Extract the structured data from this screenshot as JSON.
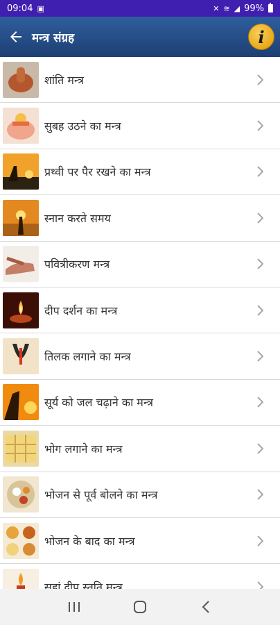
{
  "status_bar": {
    "time": "09:04",
    "battery": "99%"
  },
  "header": {
    "title": "मन्त्र संग्रह"
  },
  "items": [
    {
      "label": "शांति मन्त्र",
      "icon": "hands-namaste-icon"
    },
    {
      "label": "सुबह उठने का मन्त्र",
      "icon": "palms-open-icon"
    },
    {
      "label": "प्रथ्वी पर पैर रखने का मन्त्र",
      "icon": "yoga-sunset-icon"
    },
    {
      "label": "स्नान करते समय",
      "icon": "sun-prayer-icon"
    },
    {
      "label": "पवित्रीकरण मन्त्र",
      "icon": "water-pour-icon"
    },
    {
      "label": "दीप दर्शन का मन्त्र",
      "icon": "diya-lamp-icon"
    },
    {
      "label": "तिलक लगाने का मन्त्र",
      "icon": "tilak-icon"
    },
    {
      "label": "सूर्य को जल चढ़ाने का मन्त्र",
      "icon": "sun-offering-icon"
    },
    {
      "label": "भोग लगाने का मन्त्र",
      "icon": "sweets-plate-icon"
    },
    {
      "label": "भोजन से पूर्व बोलने का मन्त्र",
      "icon": "food-thali-icon"
    },
    {
      "label": "भोजन के बाद का मन्त्र",
      "icon": "food-bowls-icon"
    },
    {
      "label": "सहां दीप स्तुति मन्त्र",
      "icon": "candle-icon"
    }
  ],
  "colors": {
    "status_bar": "#3f1fb0",
    "app_bar": "#2a5592",
    "info_badge": "#e9a919"
  }
}
